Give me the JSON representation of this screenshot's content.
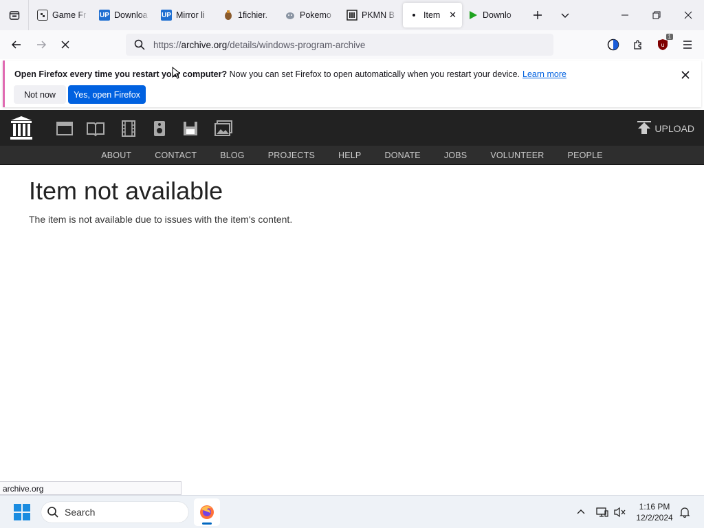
{
  "tabs": [
    {
      "title": "Game Fr",
      "favicon": "game-favicon"
    },
    {
      "title": "Downloa",
      "favicon": "upfile-favicon"
    },
    {
      "title": "Mirror li",
      "favicon": "upfile-favicon"
    },
    {
      "title": "1fichier.",
      "favicon": "1fichier-favicon"
    },
    {
      "title": "Pokemo",
      "favicon": "pokemon-favicon"
    },
    {
      "title": "PKMN B",
      "favicon": "archive-favicon"
    },
    {
      "title": "Item",
      "favicon": "loading-dot",
      "active": true
    },
    {
      "title": "Downlo",
      "favicon": "play-favicon"
    }
  ],
  "navbar": {
    "url_scheme": "https://",
    "url_host": "archive.org",
    "url_path": "/details/windows-program-archive"
  },
  "notification": {
    "bold_text": "Open Firefox every time you restart your computer?",
    "text": " Now you can set Firefox to open automatically when you restart your device.",
    "link": "Learn more",
    "not_now": "Not now",
    "yes": "Yes, open Firefox"
  },
  "ia": {
    "upload_label": "UPLOAD",
    "nav": [
      "ABOUT",
      "CONTACT",
      "BLOG",
      "PROJECTS",
      "HELP",
      "DONATE",
      "JOBS",
      "VOLUNTEER",
      "PEOPLE"
    ]
  },
  "content": {
    "title": "Item not available",
    "message": "The item is not available due to issues with the item's content."
  },
  "status": {
    "text": "archive.org"
  },
  "taskbar": {
    "search_placeholder": "Search",
    "time": "1:16 PM",
    "date": "12/2/2024",
    "ublock_badge": "1"
  },
  "colors": {
    "accent": "#0061e0",
    "ia_header": "#222222",
    "ia_nav": "#2e2e2e",
    "notice_border": "#e06ab2"
  }
}
